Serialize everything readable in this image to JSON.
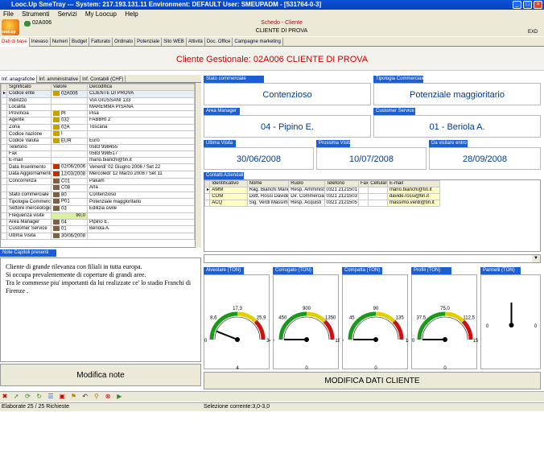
{
  "window": {
    "title": "Looc.Up SmeTray --- System: 217.193.131.11 Environment: DEFAULT User: SMEUPADM - [531764-0-3]"
  },
  "menu": [
    "File",
    "Strumenti",
    "Servizi",
    "My Loocup",
    "Help"
  ],
  "header": {
    "code": "02A006",
    "app": "Schedo - Cliente",
    "client": "CLIENTE DI PROVA",
    "exd": "EXD",
    "logo_text": "sme.up"
  },
  "tabs": [
    "Dati di base",
    "Inevaso",
    "Numeri",
    "Budget",
    "Fatturato",
    "Ordinato",
    "Potenziale",
    "Sito WEB",
    "Attività",
    "Doc. Office",
    "Campagne marketing"
  ],
  "banner": "Cliente Gestionale: 02A006 CLIENTE DI PROVA",
  "left_tabs": [
    "Inf. anagrafiche",
    "Inf. amministrative",
    "Inf. Contabili (CHF)"
  ],
  "grid": {
    "columns": [
      "Significato",
      "Valore",
      "Decodifica"
    ],
    "rows": [
      [
        "Codice ente",
        "02A006",
        "CLIENTE DI PROVA"
      ],
      [
        "Indirizzo",
        "",
        "VIA GIUSSANI 133"
      ],
      [
        "Località",
        "",
        "MAREMMA PISANA"
      ],
      [
        "Provincia",
        "PI",
        "Pisa"
      ],
      [
        "Agente",
        "032",
        "FABBRI 2"
      ],
      [
        "Zona",
        "02A",
        "Toscana"
      ],
      [
        "Codice nazione",
        "I",
        ""
      ],
      [
        "Codice Valuta",
        "EUR",
        "Euro"
      ],
      [
        "Telefono",
        "",
        "0583 998455"
      ],
      [
        "Fax",
        "",
        "0583 998517"
      ],
      [
        "E-mail",
        "",
        "mario.bianchi@tin.it"
      ],
      [
        "Data Inserimento",
        "02/06/2006",
        "Venerdi' 02 Giugno 2006 / Set 22"
      ],
      [
        "Data Aggiornamento",
        "12/03/2008",
        "Mercoledi' 12 Marzo 2008 / Set 11"
      ],
      [
        "Concorrenza",
        "C01",
        "Pakam"
      ],
      [
        "",
        "C08",
        "Arla"
      ],
      [
        "Stato commerciale",
        "80",
        "Contenzioso"
      ],
      [
        "Tipologia Commercial",
        "P01",
        "Potenziale maggioritario"
      ],
      [
        "Settore merceologico",
        "03",
        "Edilizia civile"
      ],
      [
        "Frequenza visite",
        "90,0",
        ""
      ],
      [
        "Area Manager",
        "04",
        "Pipino E."
      ],
      [
        "Customer Service",
        "01",
        "Beriola A."
      ],
      [
        "Ultima Visita",
        "30/06/2008",
        ""
      ]
    ]
  },
  "notes": {
    "header": "Note Capitoli presenti",
    "text": "Cliente di grande rilevanza con filiali in tutta europa.\nSi occupa prevalentemente di coperture di grandi aree.\nTra le commesse piu' importanti da lui realizzate ce' lo stadio Franchi di Firenze .",
    "button": "Modifica note"
  },
  "info": {
    "stato": {
      "label": "Stato commerciale",
      "value": "Contenzioso"
    },
    "tipologia": {
      "label": "Tipologia Commerciale",
      "value": "Potenziale maggioritario"
    },
    "area": {
      "label": "Area Manager",
      "value": "04 - Pipino E."
    },
    "customer": {
      "label": "Customer Service",
      "value": "01 - Beriola A."
    },
    "ultima": {
      "label": "Ultima Visita",
      "value": "30/06/2008"
    },
    "prossima": {
      "label": "Prossima Visita",
      "value": "10/07/2008"
    },
    "davisitare": {
      "label": "Da visitare entro",
      "value": "28/09/2008"
    }
  },
  "contacts": {
    "header": "Contatti Aziendali",
    "columns": [
      "Identificativo",
      "Nome",
      "Ruolo",
      "Telefono",
      "Fax",
      "Cellulare",
      "E-mail"
    ],
    "rows": [
      [
        "AMM",
        "Rag. Bianchi Mario",
        "Resp. Amministr.",
        "0321 2121501",
        "",
        "",
        "mario.bianchi@tin.it"
      ],
      [
        "COM",
        "Dott. Rossi Davide",
        "Dir. Commercial",
        "0321 2121503",
        "",
        "",
        "davide.rossi@tin.it"
      ],
      [
        "ACQ",
        "Sig. Verdi Massimo",
        "Resp. Acquisti",
        "0321 2121505",
        "",
        "",
        "massimo.verdi@tin.it"
      ]
    ]
  },
  "gauges": [
    {
      "label": "Alveolare (TON)",
      "min": "0,0",
      "t1": "8,6",
      "t2": "17,3",
      "t3": "25,9",
      "max": "34,5",
      "value": "4",
      "fraction": 0.12
    },
    {
      "label": "Corrugato (TON)",
      "min": "0",
      "t1": "450",
      "t2": "900",
      "t3": "1350",
      "max": "1800",
      "value": "0",
      "fraction": 0.0
    },
    {
      "label": "Compatta (TON)",
      "min": "0",
      "t1": "45",
      "t2": "90",
      "t3": "135",
      "max": "180",
      "value": "0",
      "fraction": 0.0
    },
    {
      "label": "Profili (TON)",
      "min": "0,0",
      "t1": "37,5",
      "t2": "75,0",
      "t3": "112,5",
      "max": "150,0",
      "value": "0",
      "fraction": 0.0
    },
    {
      "label": "Pannelli (TON)",
      "min": "0",
      "t1": "",
      "t2": "",
      "t3": "",
      "max": "0",
      "value": "",
      "fraction": 0.5
    }
  ],
  "modify_button": "MODIFICA DATI CLIENTE",
  "status": {
    "left": "Elaborate 25 / 25 Richieste",
    "right": "Selezione corrente:3,0-3,0"
  },
  "colors": {
    "accent": "#1c5fd4",
    "banner": "#cc0000",
    "value": "#003a8c"
  }
}
